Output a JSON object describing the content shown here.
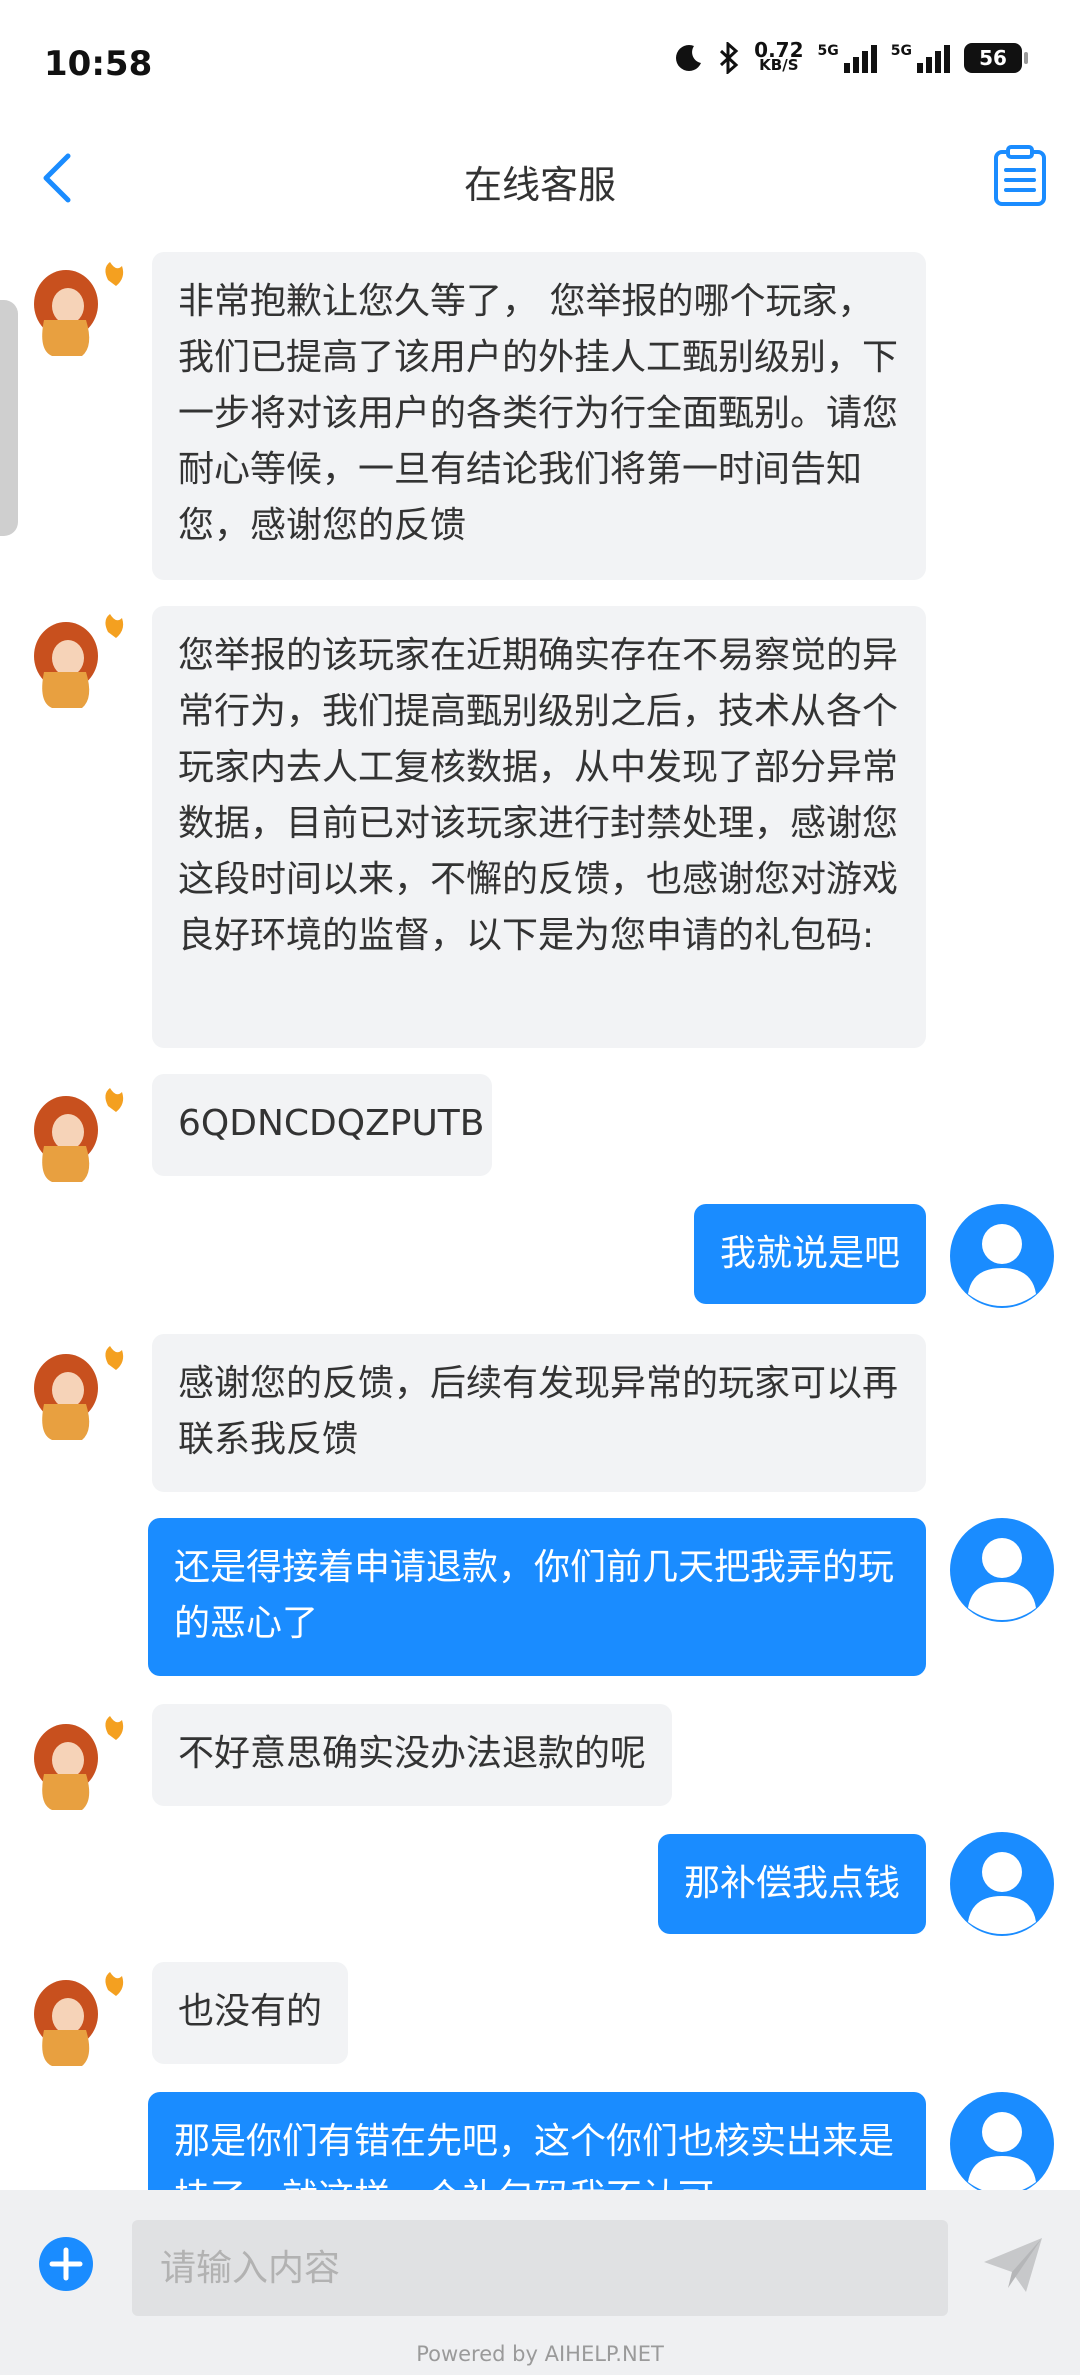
{
  "status_bar": {
    "time": "10:58",
    "net_speed_value": "0.72",
    "net_speed_unit": "KB/S",
    "sim1_label": "5G",
    "sim2_label": "5G",
    "battery": "56"
  },
  "header": {
    "title": "在线客服",
    "back_icon": "chevron-left-icon",
    "right_icon": "clipboard-list-icon"
  },
  "colors": {
    "accent": "#1a8cff",
    "agent_bubble": "#f2f3f5",
    "input_bar_bg": "#eff0f2"
  },
  "messages": [
    {
      "from": "agent",
      "text": "非常抱歉让您久等了， 您举报的哪个玩家，我们已提高了该用户的外挂人工甄别级别，下一步将对该用户的各类行为行全面甄别。请您耐心等候，一旦有结论我们将第一时间告知您，感谢您的反馈"
    },
    {
      "from": "agent",
      "text": "您举报的该玩家在近期确实存在不易察觉的异常行为，我们提高甄别级别之后，技术从各个玩家内去人工复核数据，从中发现了部分异常数据，目前已对该玩家进行封禁处理，感谢您这段时间以来，不懈的反馈，也感谢您对游戏良好环境的监督，以下是为您申请的礼包码:"
    },
    {
      "from": "agent",
      "text": "6QDNCDQZPUTB"
    },
    {
      "from": "user",
      "text": "我就说是吧"
    },
    {
      "from": "agent",
      "text": "感谢您的反馈，后续有发现异常的玩家可以再联系我反馈"
    },
    {
      "from": "user",
      "text": "还是得接着申请退款，你们前几天把我弄的玩的恶心了"
    },
    {
      "from": "agent",
      "text": "不好意思确实没办法退款的呢"
    },
    {
      "from": "user",
      "text": "那补偿我点钱"
    },
    {
      "from": "agent",
      "text": "也没有的"
    },
    {
      "from": "user",
      "text": "那是你们有错在先吧，这个你们也核实出来是挂了，就这样一个礼包码我不认可"
    }
  ],
  "input": {
    "placeholder": "请输入内容",
    "value": "",
    "add_icon": "plus-circle-icon",
    "send_icon": "paper-plane-icon"
  },
  "footer": {
    "powered_by": "Powered by AIHELP.NET"
  }
}
